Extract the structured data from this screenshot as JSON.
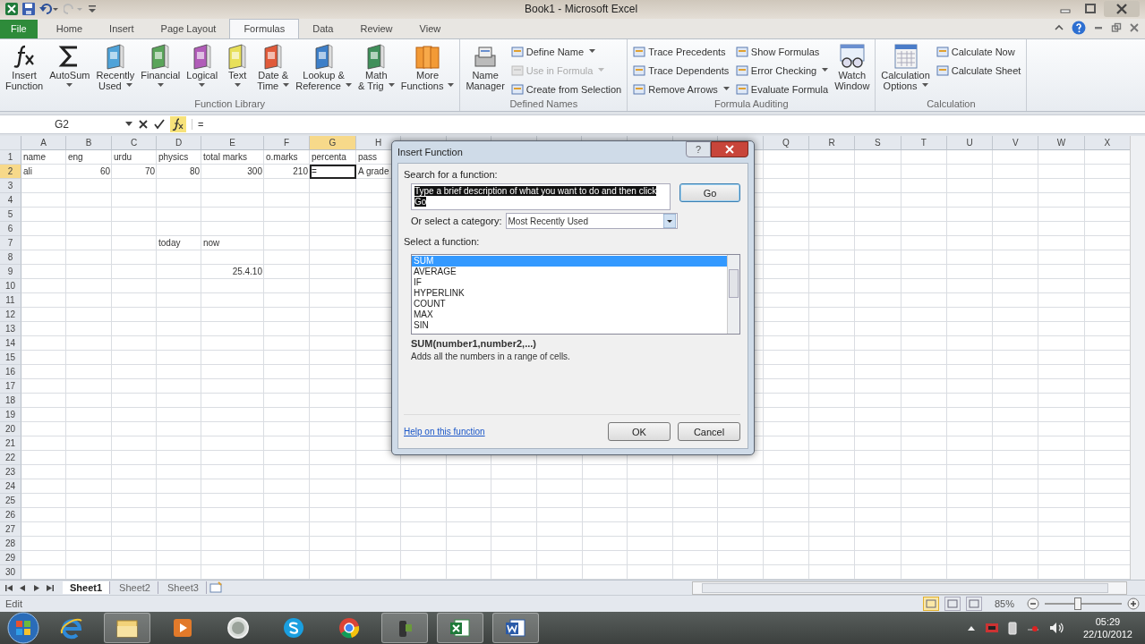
{
  "window": {
    "title": "Book1  -  Microsoft Excel"
  },
  "tabs": [
    {
      "label": "File",
      "kind": "file",
      "selected": false
    },
    {
      "label": "Home",
      "kind": "tab",
      "selected": false
    },
    {
      "label": "Insert",
      "kind": "tab",
      "selected": false
    },
    {
      "label": "Page Layout",
      "kind": "tab",
      "selected": false
    },
    {
      "label": "Formulas",
      "kind": "tab",
      "selected": true
    },
    {
      "label": "Data",
      "kind": "tab",
      "selected": false
    },
    {
      "label": "Review",
      "kind": "tab",
      "selected": false
    },
    {
      "label": "View",
      "kind": "tab",
      "selected": false
    }
  ],
  "ribbon": {
    "groups": [
      {
        "label": "Function Library",
        "items": [
          {
            "kind": "fx",
            "lines": [
              "Insert",
              "Function"
            ],
            "dropdown": false
          },
          {
            "kind": "sigma",
            "lines": [
              "AutoSum"
            ],
            "dropdown": true
          },
          {
            "kind": "book",
            "color": "#4fa3d9",
            "lines": [
              "Recently",
              "Used"
            ],
            "dropdown": true
          },
          {
            "kind": "book",
            "color": "#5aa45a",
            "lines": [
              "Financial"
            ],
            "dropdown": true
          },
          {
            "kind": "book",
            "color": "#b05cb8",
            "lines": [
              "Logical"
            ],
            "dropdown": true
          },
          {
            "kind": "book",
            "color": "#e8e05a",
            "lines": [
              "Text"
            ],
            "dropdown": true
          },
          {
            "kind": "book",
            "color": "#e05a3a",
            "lines": [
              "Date &",
              "Time"
            ],
            "dropdown": true
          },
          {
            "kind": "book",
            "color": "#3d7fc8",
            "lines": [
              "Lookup &",
              "Reference"
            ],
            "dropdown": true
          },
          {
            "kind": "book",
            "color": "#3f8f5a",
            "lines": [
              "Math",
              "& Trig"
            ],
            "dropdown": true
          },
          {
            "kind": "books",
            "lines": [
              "More",
              "Functions"
            ],
            "dropdown": true
          }
        ]
      },
      {
        "label": "Defined Names",
        "items": [
          {
            "kind": "cards",
            "lines": [
              "Name",
              "Manager"
            ],
            "dropdown": false
          },
          {
            "kind": "stack",
            "buttons": [
              {
                "label": "Define Name",
                "dropdown": true,
                "disabled": false
              },
              {
                "label": "Use in Formula",
                "dropdown": true,
                "disabled": true
              },
              {
                "label": "Create from Selection",
                "dropdown": false,
                "disabled": false
              }
            ]
          }
        ]
      },
      {
        "label": "Formula Auditing",
        "items": [
          {
            "kind": "stack",
            "buttons": [
              {
                "label": "Trace Precedents",
                "dropdown": false,
                "disabled": false
              },
              {
                "label": "Trace Dependents",
                "dropdown": false,
                "disabled": false
              },
              {
                "label": "Remove Arrows",
                "dropdown": true,
                "disabled": false
              }
            ]
          },
          {
            "kind": "stack",
            "buttons": [
              {
                "label": "Show Formulas",
                "dropdown": false,
                "disabled": false
              },
              {
                "label": "Error Checking",
                "dropdown": true,
                "disabled": false
              },
              {
                "label": "Evaluate Formula",
                "dropdown": false,
                "disabled": false
              }
            ]
          },
          {
            "kind": "glasses",
            "lines": [
              "Watch",
              "Window"
            ],
            "dropdown": false
          }
        ]
      },
      {
        "label": "Calculation",
        "items": [
          {
            "kind": "calculator",
            "lines": [
              "Calculation",
              "Options"
            ],
            "dropdown": true
          },
          {
            "kind": "stack",
            "buttons": [
              {
                "label": "Calculate Now",
                "dropdown": false,
                "disabled": false
              },
              {
                "label": "Calculate Sheet",
                "dropdown": false,
                "disabled": false
              }
            ]
          }
        ]
      }
    ]
  },
  "formula_bar": {
    "name_box": "G2",
    "formula": "="
  },
  "sheet": {
    "columns_left": [
      {
        "label": "A",
        "selected": false
      },
      {
        "label": "B",
        "selected": false
      },
      {
        "label": "C",
        "selected": false
      },
      {
        "label": "D",
        "selected": false
      },
      {
        "label": "E",
        "selected": false
      },
      {
        "label": "F",
        "selected": false
      },
      {
        "label": "G",
        "selected": true
      },
      {
        "label": "H",
        "selected": false
      }
    ],
    "columns_right": [
      {
        "label": "Q"
      },
      {
        "label": "R"
      },
      {
        "label": "S"
      },
      {
        "label": "T"
      },
      {
        "label": "U"
      },
      {
        "label": "V"
      },
      {
        "label": "W"
      },
      {
        "label": "X"
      }
    ],
    "rows": [
      {
        "number": "1",
        "selected": false,
        "cells": [
          {
            "value": "name",
            "kind": "text",
            "selected": false
          },
          {
            "value": "eng",
            "kind": "text",
            "selected": false
          },
          {
            "value": "urdu",
            "kind": "text",
            "selected": false
          },
          {
            "value": "physics",
            "kind": "text",
            "selected": false
          },
          {
            "value": "total marks",
            "kind": "text",
            "selected": false
          },
          {
            "value": "o.marks",
            "kind": "text",
            "selected": false
          },
          {
            "value": "percenta",
            "kind": "text",
            "selected": false
          },
          {
            "value": "pass",
            "kind": "text",
            "selected": false
          }
        ]
      },
      {
        "number": "2",
        "selected": true,
        "cells": [
          {
            "value": "ali",
            "kind": "text",
            "selected": false
          },
          {
            "value": "60",
            "kind": "number",
            "selected": false
          },
          {
            "value": "70",
            "kind": "number",
            "selected": false
          },
          {
            "value": "80",
            "kind": "number",
            "selected": false
          },
          {
            "value": "300",
            "kind": "number",
            "selected": false
          },
          {
            "value": "210",
            "kind": "number",
            "selected": false
          },
          {
            "value": "=",
            "kind": "text",
            "selected": true
          },
          {
            "value": "A grade",
            "kind": "text",
            "selected": false
          }
        ]
      },
      {
        "number": "3",
        "selected": false
      },
      {
        "number": "4",
        "selected": false
      },
      {
        "number": "5",
        "selected": false
      },
      {
        "number": "6",
        "selected": false
      },
      {
        "number": "7",
        "selected": false,
        "cells": [
          null,
          null,
          null,
          {
            "value": "today",
            "kind": "text",
            "selected": false
          },
          {
            "value": "now",
            "kind": "text",
            "selected": false
          }
        ]
      },
      {
        "number": "8",
        "selected": false
      },
      {
        "number": "9",
        "selected": false,
        "cells": [
          null,
          null,
          null,
          null,
          {
            "value": "25.4.10",
            "kind": "number",
            "selected": false
          }
        ]
      },
      {
        "number": "10",
        "selected": false
      },
      {
        "number": "11",
        "selected": false
      },
      {
        "number": "12",
        "selected": false
      },
      {
        "number": "13",
        "selected": false
      },
      {
        "number": "14",
        "selected": false
      },
      {
        "number": "15",
        "selected": false
      },
      {
        "number": "16",
        "selected": false
      },
      {
        "number": "17",
        "selected": false
      },
      {
        "number": "18",
        "selected": false
      },
      {
        "number": "19",
        "selected": false
      },
      {
        "number": "20",
        "selected": false
      },
      {
        "number": "21",
        "selected": false
      },
      {
        "number": "22",
        "selected": false
      },
      {
        "number": "23",
        "selected": false
      },
      {
        "number": "24",
        "selected": false
      },
      {
        "number": "25",
        "selected": false
      },
      {
        "number": "26",
        "selected": false
      },
      {
        "number": "27",
        "selected": false
      },
      {
        "number": "28",
        "selected": false
      },
      {
        "number": "29",
        "selected": false
      },
      {
        "number": "30",
        "selected": false
      }
    ],
    "tabs": [
      {
        "label": "Sheet1",
        "selected": true
      },
      {
        "label": "Sheet2",
        "selected": false
      },
      {
        "label": "Sheet3",
        "selected": false
      }
    ]
  },
  "dialog": {
    "title": "Insert Function",
    "help": "?",
    "search_label": "Search for a function:",
    "search_value": "Type a brief description of what you want to do and then click Go",
    "go": "Go",
    "category_label": "Or select a category:",
    "category": "Most Recently Used",
    "list_label": "Select a function:",
    "functions": [
      {
        "label": "SUM",
        "selected": true
      },
      {
        "label": "AVERAGE",
        "selected": false
      },
      {
        "label": "IF",
        "selected": false
      },
      {
        "label": "HYPERLINK",
        "selected": false
      },
      {
        "label": "COUNT",
        "selected": false
      },
      {
        "label": "MAX",
        "selected": false
      },
      {
        "label": "SIN",
        "selected": false
      }
    ],
    "signature": "SUM(number1,number2,...)",
    "description": "Adds all the numbers in a range of cells.",
    "help_link": "Help on this function",
    "buttons": [
      "OK",
      "Cancel"
    ]
  },
  "status_bar": {
    "mode": "Edit",
    "views": [
      {
        "selected": true
      },
      {
        "selected": false
      },
      {
        "selected": false
      }
    ],
    "zoom": {
      "reading": "85%",
      "level": 0.43
    }
  },
  "taskbar": {
    "items": [
      {
        "kind": "ie",
        "open": false
      },
      {
        "kind": "folder",
        "open": true
      },
      {
        "kind": "media",
        "open": false
      },
      {
        "kind": "disc",
        "open": false
      },
      {
        "kind": "skype",
        "open": false
      },
      {
        "kind": "chrome",
        "open": false
      },
      {
        "kind": "camera",
        "open": true
      },
      {
        "kind": "excel",
        "open": true
      },
      {
        "kind": "word",
        "open": true
      }
    ],
    "clock": {
      "time": "05:29",
      "date": "22/10/2012"
    }
  }
}
